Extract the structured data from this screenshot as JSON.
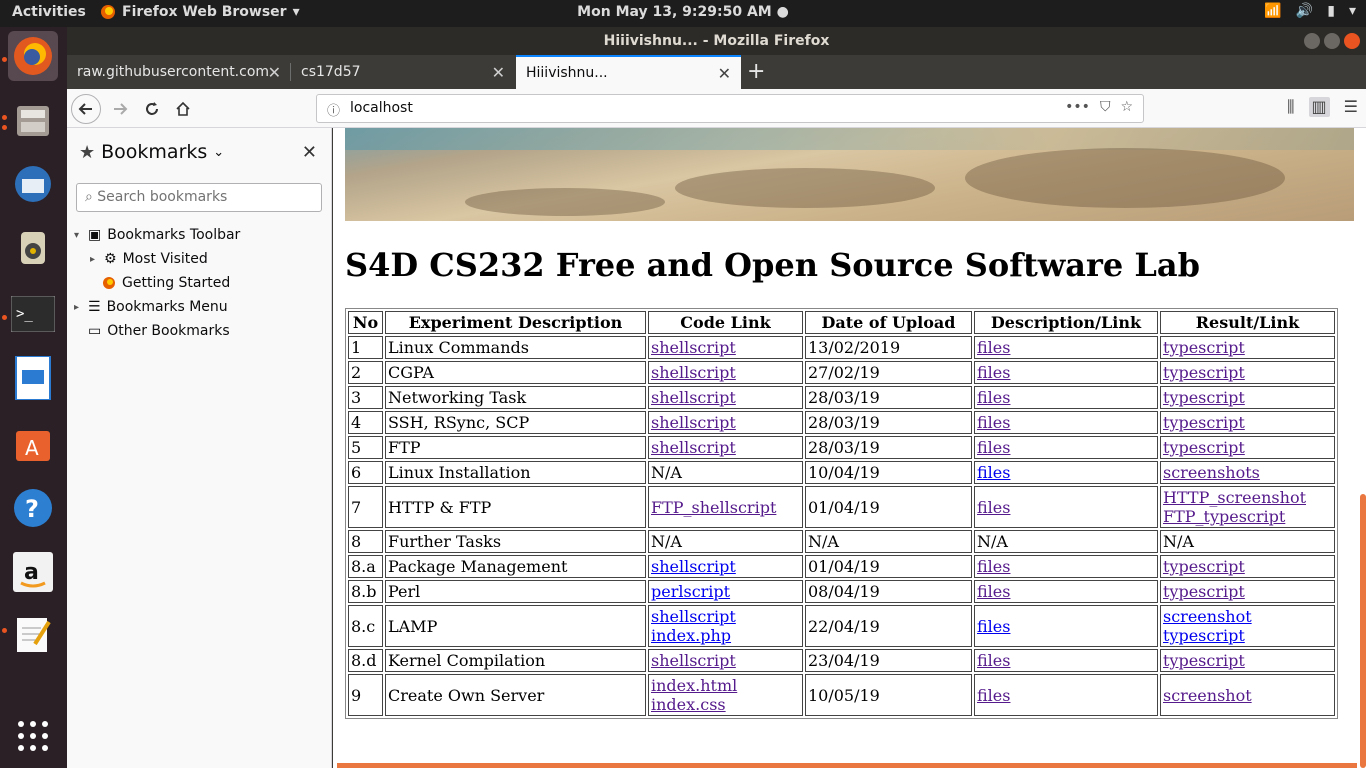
{
  "topbar": {
    "activities": "Activities",
    "app_name": "Firefox Web Browser",
    "clock": "Mon May 13,  9:29:50 AM"
  },
  "window": {
    "title": "Hiiivishnu... - Mozilla Firefox"
  },
  "tabs": [
    {
      "label": "raw.githubusercontent.com"
    },
    {
      "label": "cs17d57"
    },
    {
      "label": "Hiiivishnu..."
    }
  ],
  "navbar": {
    "url": "localhost"
  },
  "sidebar": {
    "title": "Bookmarks",
    "search_placeholder": "Search bookmarks",
    "tree": {
      "toolbar": "Bookmarks Toolbar",
      "most_visited": "Most Visited",
      "getting_started": "Getting Started",
      "menu": "Bookmarks Menu",
      "other": "Other Bookmarks"
    }
  },
  "page": {
    "title": "S4D CS232 Free and Open Source Software Lab",
    "table": {
      "headers": [
        "No",
        "Experiment Description",
        "Code Link",
        "Date of Upload",
        "Description/Link",
        "Result/Link"
      ],
      "rows": [
        {
          "no": "1",
          "desc": "Linux Commands",
          "code": [
            "shellscript"
          ],
          "date": "13/02/2019",
          "link": "files",
          "result": [
            "typescript"
          ]
        },
        {
          "no": "2",
          "desc": "CGPA",
          "code": [
            "shellscript"
          ],
          "date": "27/02/19",
          "link": "files",
          "result": [
            "typescript"
          ]
        },
        {
          "no": "3",
          "desc": "Networking Task",
          "code": [
            "shellscript"
          ],
          "date": "28/03/19",
          "link": "files",
          "result": [
            "typescript"
          ]
        },
        {
          "no": "4",
          "desc": "SSH, RSync, SCP",
          "code": [
            "shellscript"
          ],
          "date": "28/03/19",
          "link": "files",
          "result": [
            "typescript"
          ]
        },
        {
          "no": "5",
          "desc": "FTP",
          "code": [
            "shellscript"
          ],
          "date": "28/03/19",
          "link": "files",
          "result": [
            "typescript"
          ]
        },
        {
          "no": "6",
          "desc": "Linux Installation",
          "code_text": "N/A",
          "date": "10/04/19",
          "link": "files",
          "result": [
            "screenshots"
          ]
        },
        {
          "no": "7",
          "desc": "HTTP & FTP",
          "code": [
            "FTP_shellscript"
          ],
          "date": "01/04/19",
          "link": "files",
          "result": [
            "HTTP_screenshot",
            "FTP_typescript"
          ]
        },
        {
          "no": "8",
          "desc": "Further Tasks",
          "code_text": "N/A",
          "date": "N/A",
          "link_text": "N/A",
          "result_text": "N/A"
        },
        {
          "no": "8.a",
          "desc": "Package Management",
          "code": [
            "shellscript"
          ],
          "date": "01/04/19",
          "link": "files",
          "result": [
            "typescript"
          ]
        },
        {
          "no": "8.b",
          "desc": "Perl",
          "code": [
            "perlscript"
          ],
          "date": "08/04/19",
          "link": "files",
          "result": [
            "typescript"
          ]
        },
        {
          "no": "8.c",
          "desc": "LAMP",
          "code": [
            "shellscript",
            "index.php"
          ],
          "date": "22/04/19",
          "link": "files",
          "result": [
            "screenshot",
            "typescript"
          ]
        },
        {
          "no": "8.d",
          "desc": "Kernel Compilation",
          "code": [
            "shellscript"
          ],
          "date": "23/04/19",
          "link": "files",
          "result": [
            "typescript"
          ]
        },
        {
          "no": "9",
          "desc": "Create Own Server",
          "code": [
            "index.html",
            "index.css"
          ],
          "date": "10/05/19",
          "link": "files",
          "result": [
            "screenshot"
          ]
        }
      ]
    }
  },
  "colors": {
    "accent": "#e95420",
    "visited_link": "#551a8b",
    "link": "#0000ee"
  }
}
